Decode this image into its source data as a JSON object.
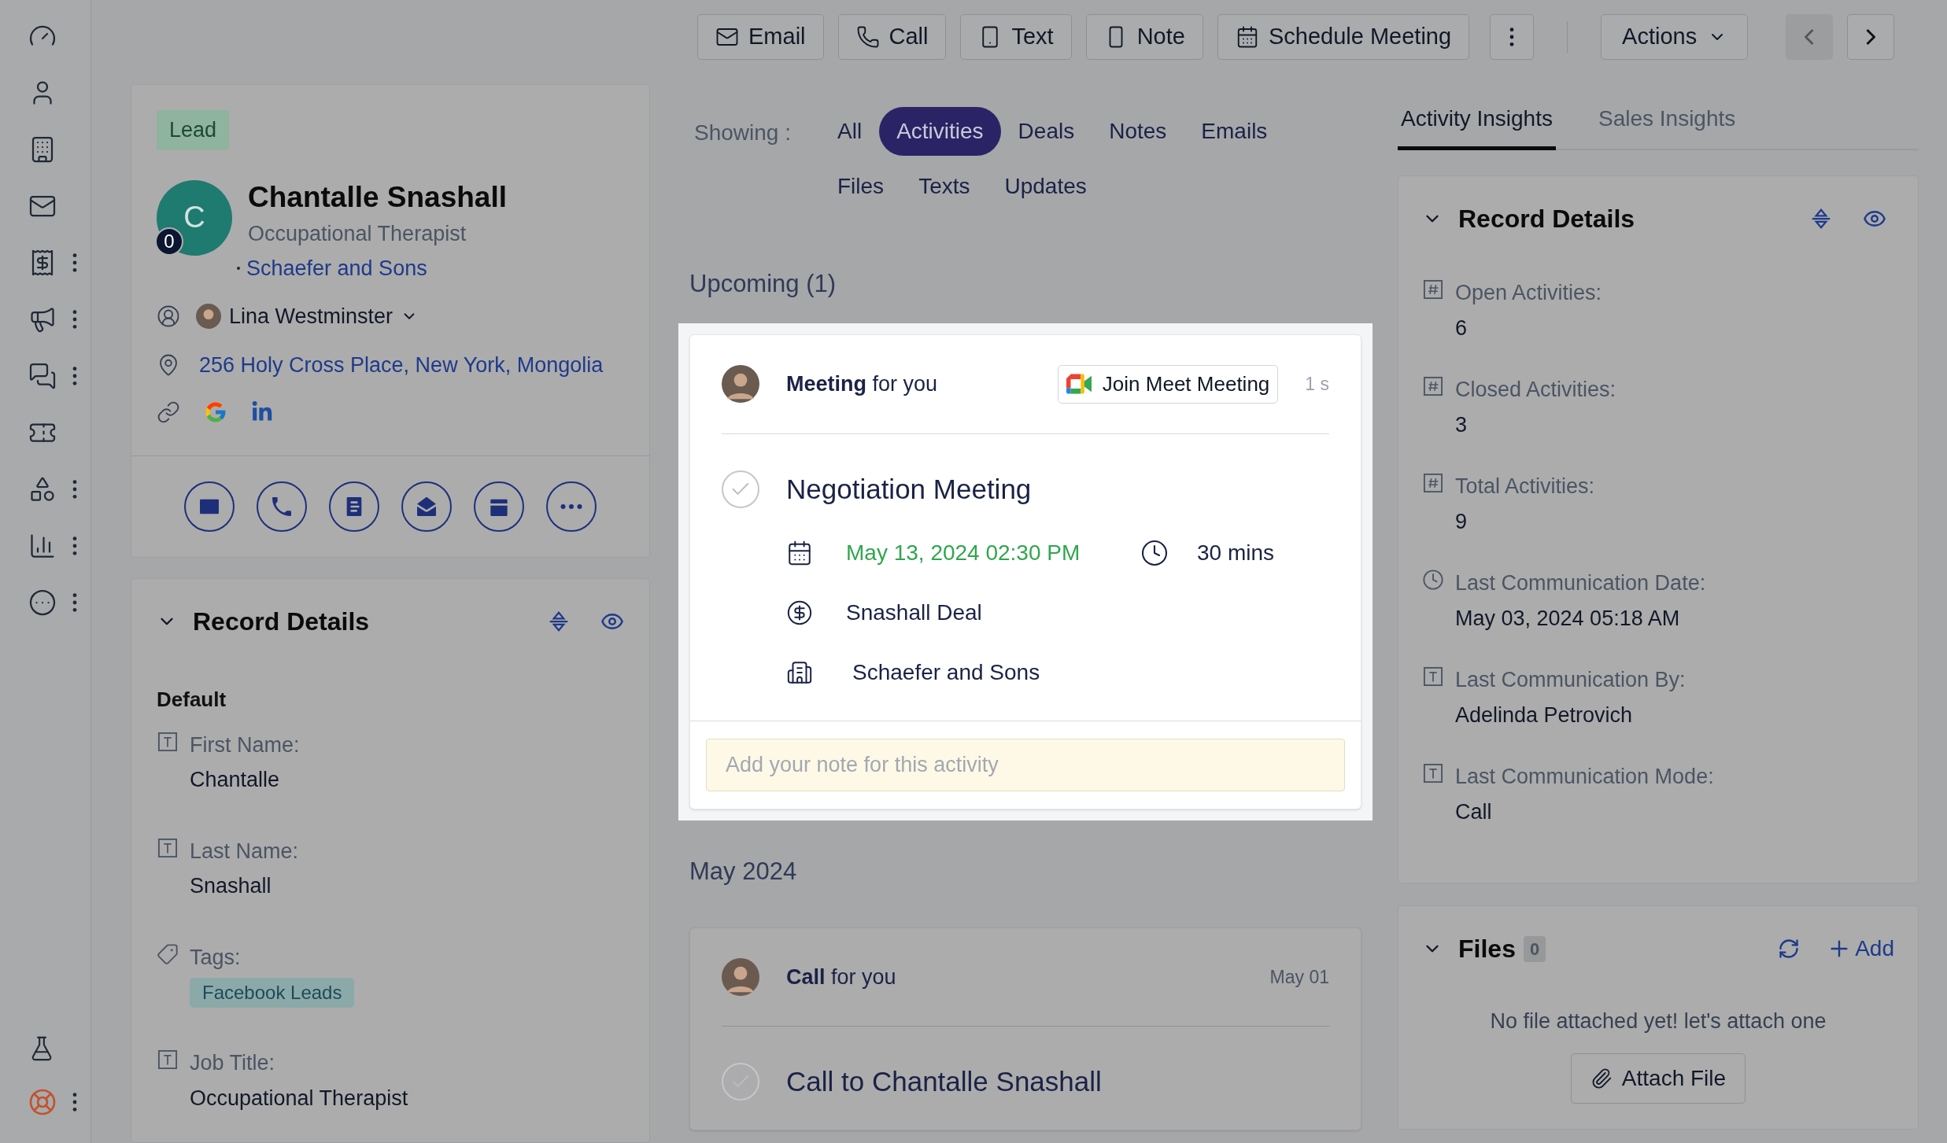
{
  "toolbar": {
    "buttons": [
      {
        "label": "Email"
      },
      {
        "label": "Call"
      },
      {
        "label": "Text"
      },
      {
        "label": "Note"
      },
      {
        "label": "Schedule Meeting"
      }
    ],
    "actions": "Actions"
  },
  "lead": {
    "badge": "Lead",
    "avatar_initial": "C",
    "avatar_count": "0",
    "name": "Chantalle Snashall",
    "title": "Occupational Therapist",
    "company": "Schaefer and Sons",
    "owner": "Lina Westminster",
    "address": "256 Holy Cross Place, New York, Mongolia"
  },
  "record_details": {
    "title": "Record Details",
    "section": "Default",
    "fields": [
      {
        "kind": "text",
        "label": "First Name:",
        "value": "Chantalle"
      },
      {
        "kind": "text",
        "label": "Last Name:",
        "value": "Snashall"
      },
      {
        "kind": "tags",
        "label": "Tags:",
        "tags": [
          "Facebook Leads"
        ]
      },
      {
        "kind": "text",
        "label": "Job Title:",
        "value": "Occupational Therapist"
      }
    ]
  },
  "filters": {
    "label": "Showing :",
    "tabs": [
      {
        "label": "All",
        "selected": false
      },
      {
        "label": "Activities",
        "selected": true
      },
      {
        "label": "Deals",
        "selected": false
      },
      {
        "label": "Notes",
        "selected": false
      },
      {
        "label": "Emails",
        "selected": false
      },
      {
        "label": "Files",
        "selected": false
      },
      {
        "label": "Texts",
        "selected": false
      },
      {
        "label": "Updates",
        "selected": false
      }
    ]
  },
  "upcoming": {
    "heading": "Upcoming (1)",
    "card": {
      "spotlight": true,
      "header": "**Meeting** for you",
      "join": "Join Meet Meeting",
      "time": "1 s",
      "title": "Negotiation Meeting",
      "completed": false,
      "date": "May 13, 2024 02:30 PM",
      "duration": "30 mins",
      "deal": "Snashall Deal",
      "company": "Schaefer and Sons",
      "note_placeholder": "Add your note for this activity"
    }
  },
  "month": {
    "heading": "May 2024",
    "card": {
      "header": "**Call** for you",
      "time": "May 01",
      "title": "Call to Chantalle Snashall",
      "completed": false
    }
  },
  "insights": {
    "tabs": [
      {
        "label": "Activity Insights",
        "selected": true
      },
      {
        "label": "Sales Insights",
        "selected": false
      }
    ],
    "record_details": {
      "title": "Record Details",
      "fields": [
        {
          "kind": "number",
          "label": "Open Activities:",
          "value": "6"
        },
        {
          "kind": "number",
          "label": "Closed Activities:",
          "value": "3"
        },
        {
          "kind": "number",
          "label": "Total Activities:",
          "value": "9"
        },
        {
          "kind": "date",
          "label": "Last Communication Date:",
          "value": "May 03, 2024 05:18 AM"
        },
        {
          "kind": "text",
          "label": "Last Communication By:",
          "value": "Adelinda Petrovich"
        },
        {
          "kind": "text",
          "label": "Last Communication Mode:",
          "value": "Call"
        }
      ]
    },
    "files": {
      "title": "Files",
      "count": "0",
      "add": "Add",
      "empty": "No file attached yet! let's attach one",
      "attach": "Attach File"
    }
  }
}
